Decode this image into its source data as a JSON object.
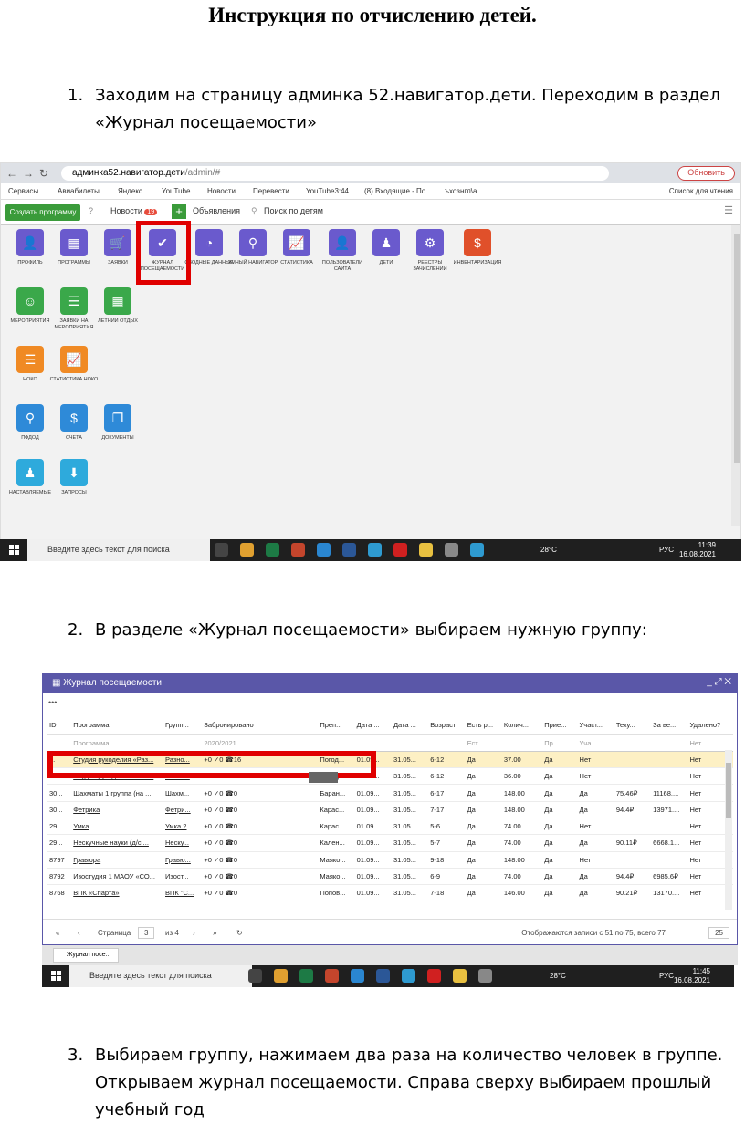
{
  "doc": {
    "title": "Инструкция по отчислению детей.",
    "step1": {
      "num": "1.",
      "text": "Заходим на страницу админка 52.навигатор.дети. Переходим в раздел «Журнал посещаемости»"
    },
    "step2": {
      "num": "2.",
      "text": "В разделе «Журнал посещаемости» выбираем нужную группу:"
    },
    "step3": {
      "num": "3.",
      "text": "Выбираем группу, нажимаем два раза на количество человек в группе. Открываем журнал посещаемости. Справа сверху выбираем прошлый учебный год"
    }
  },
  "browser": {
    "url_host": "админка52.навигатор.дети",
    "url_path": "/admin/#",
    "update_label": "Обновить",
    "bookmarks": [
      "Сервисы",
      "Авиабилеты",
      "Яндекс",
      "YouTube",
      "Новости",
      "Перевести",
      "YouTube3:44",
      "(8) Входящие - По...",
      "ъхознгл\\а"
    ],
    "reading_list": "Список для чтения"
  },
  "toolbar": {
    "create_label": "Создать программу",
    "news_label": "Новости",
    "news_badge": "19",
    "ads_label": "Объявления",
    "search_label": "Поиск по детям"
  },
  "apps": [
    {
      "label": "ПРОФИЛЬ",
      "color": "#6a5acd",
      "glyph": "👤"
    },
    {
      "label": "ПРОГРАММЫ",
      "color": "#6a5acd",
      "glyph": "▦"
    },
    {
      "label": "ЗАЯВКИ",
      "color": "#6a5acd",
      "glyph": "🛒"
    },
    {
      "label": "ЖУРНАЛ ПОСЕЩАЕМОСТИ",
      "color": "#6a5acd",
      "glyph": "✔"
    },
    {
      "label": "СВОДНЫЕ ДАННЫЕ",
      "color": "#6a5acd",
      "glyph": "◔"
    },
    {
      "label": "УМНЫЙ НАВИГАТОР",
      "color": "#6a5acd",
      "glyph": "⚲"
    },
    {
      "label": "СТАТИСТИКА",
      "color": "#6a5acd",
      "glyph": "📈"
    },
    {
      "label": "ПОЛЬЗОВАТЕЛИ САЙТА",
      "color": "#6a5acd",
      "glyph": "👤"
    },
    {
      "label": "ДЕТИ",
      "color": "#6a5acd",
      "glyph": "♟"
    },
    {
      "label": "РЕЕСТРЫ ЗАЧИСЛЕНИЙ",
      "color": "#6a5acd",
      "glyph": "⚙"
    },
    {
      "label": "ИНВЕНТАРИЗАЦИЯ",
      "color": "#e0502a",
      "glyph": "$"
    },
    {
      "label": "МЕРОПРИЯТИЯ",
      "color": "#3aa84a",
      "glyph": "☺"
    },
    {
      "label": "ЗАЯВКИ НА МЕРОПРИЯТИЯ",
      "color": "#3aa84a",
      "glyph": "☰"
    },
    {
      "label": "ЛЕТНИЙ ОТДЫХ",
      "color": "#3aa84a",
      "glyph": "▦"
    },
    {
      "label": "НОКО",
      "color": "#f08a24",
      "glyph": "☰"
    },
    {
      "label": "СТАТИСТИКА НОКО",
      "color": "#f08a24",
      "glyph": "📈"
    },
    {
      "label": "ПФДОД",
      "color": "#2e8ad8",
      "glyph": "⚲"
    },
    {
      "label": "СЧЕТА",
      "color": "#2e8ad8",
      "glyph": "$"
    },
    {
      "label": "ДОКУМЕНТЫ",
      "color": "#2e8ad8",
      "glyph": "❐"
    },
    {
      "label": "НАСТАВЛЯЕМЫЕ",
      "color": "#2eaadc",
      "glyph": "♟"
    },
    {
      "label": "ЗАПРОСЫ",
      "color": "#2eaadc",
      "glyph": "⬇"
    }
  ],
  "taskbar1": {
    "search_text": "Введите здесь текст для поиска",
    "weather": "28°C",
    "lang": "РУС",
    "time": "11:39",
    "date": "16.08.2021"
  },
  "taskbar2": {
    "search_text": "Введите здесь текст для поиска",
    "weather": "28°C",
    "lang": "РУС",
    "time": "11:45",
    "date": "16.08.2021"
  },
  "journal": {
    "title": "Журнал посещаемости",
    "controls": "_ ⤢ ✕",
    "dots": "•••",
    "columns": [
      "ID",
      "Программа",
      "Групп...",
      "Забронировано",
      "Преп...",
      "Дата ...",
      "Дата ...",
      "Возраст",
      "Есть р...",
      "Колич...",
      "Прие...",
      "Участ...",
      "Теку...",
      "За ве...",
      "Удалено?"
    ],
    "filters": [
      "...",
      "Программа...",
      "...",
      "2020/2021",
      "...",
      "...",
      "...",
      "...",
      "Ест",
      "...",
      "Пр",
      "Уча",
      "...",
      "...",
      "Нет"
    ],
    "rows": [
      [
        "...",
        "Студия рукоделия «Раз...",
        "Разно...",
        "+0 ✓0 ☎16",
        "Погод...",
        "01.09...",
        "31.05...",
        "6-12",
        "Да",
        "37.00",
        "Да",
        "Нет",
        "",
        "",
        "Нет"
      ],
      [
        "30...",
        "Студия рукоделия «Раз...",
        "Разно...",
        "+0 ✓0 ☎15",
        "Погод...",
        "01.09...",
        "31.05...",
        "6-12",
        "Да",
        "36.00",
        "Да",
        "Нет",
        "",
        "",
        "Нет"
      ],
      [
        "30...",
        "Шахматы 1 группа (на ...",
        "Шахм...",
        "+0 ✓0 ☎0",
        "Баран...",
        "01.09...",
        "31.05...",
        "6-17",
        "Да",
        "148.00",
        "Да",
        "Да",
        "75.46₽",
        "11168....",
        "Нет"
      ],
      [
        "30...",
        "Фетрика",
        "Фетри...",
        "+0 ✓0 ☎0",
        "Карас...",
        "01.09...",
        "31.05...",
        "7-17",
        "Да",
        "148.00",
        "Да",
        "Да",
        "94.4₽",
        "13971....",
        "Нет"
      ],
      [
        "29...",
        "Умка",
        "Умка 2",
        "+0 ✓0 ☎0",
        "Карас...",
        "01.09...",
        "31.05...",
        "5-6",
        "Да",
        "74.00",
        "Да",
        "Нет",
        "",
        "",
        "Нет"
      ],
      [
        "29...",
        "Нескучные науки (д/с ...",
        "Неску...",
        "+0 ✓0 ☎0",
        "Кален...",
        "01.09...",
        "31.05...",
        "5-7",
        "Да",
        "74.00",
        "Да",
        "Да",
        "90.11₽",
        "6668.1...",
        "Нет"
      ],
      [
        "8797",
        "Гравюра",
        "Гравю...",
        "+0 ✓0 ☎0",
        "Маяко...",
        "01.09...",
        "31.05...",
        "9-18",
        "Да",
        "148.00",
        "Да",
        "Нет",
        "",
        "",
        "Нет"
      ],
      [
        "8792",
        "Изостудия 1 МАОУ «СО...",
        "Изост...",
        "+0 ✓0 ☎0",
        "Маяко...",
        "01.09...",
        "31.05...",
        "6-9",
        "Да",
        "74.00",
        "Да",
        "Да",
        "94.4₽",
        "6985.6₽",
        "Нет"
      ],
      [
        "8768",
        "ВПК «Спарта»",
        "ВПК \"С...",
        "+0 ✓0 ☎0",
        "Попов...",
        "01.09...",
        "31.05...",
        "7-18",
        "Да",
        "146.00",
        "Да",
        "Да",
        "90.21₽",
        "13170....",
        "Нет"
      ]
    ],
    "pager": {
      "page_label": "Страница",
      "page": "3",
      "of_label": "из 4",
      "summary": "Отображаются записи с 51 по 75, всего 77",
      "page_size": "25"
    },
    "tab_label": "Журнал посе..."
  }
}
